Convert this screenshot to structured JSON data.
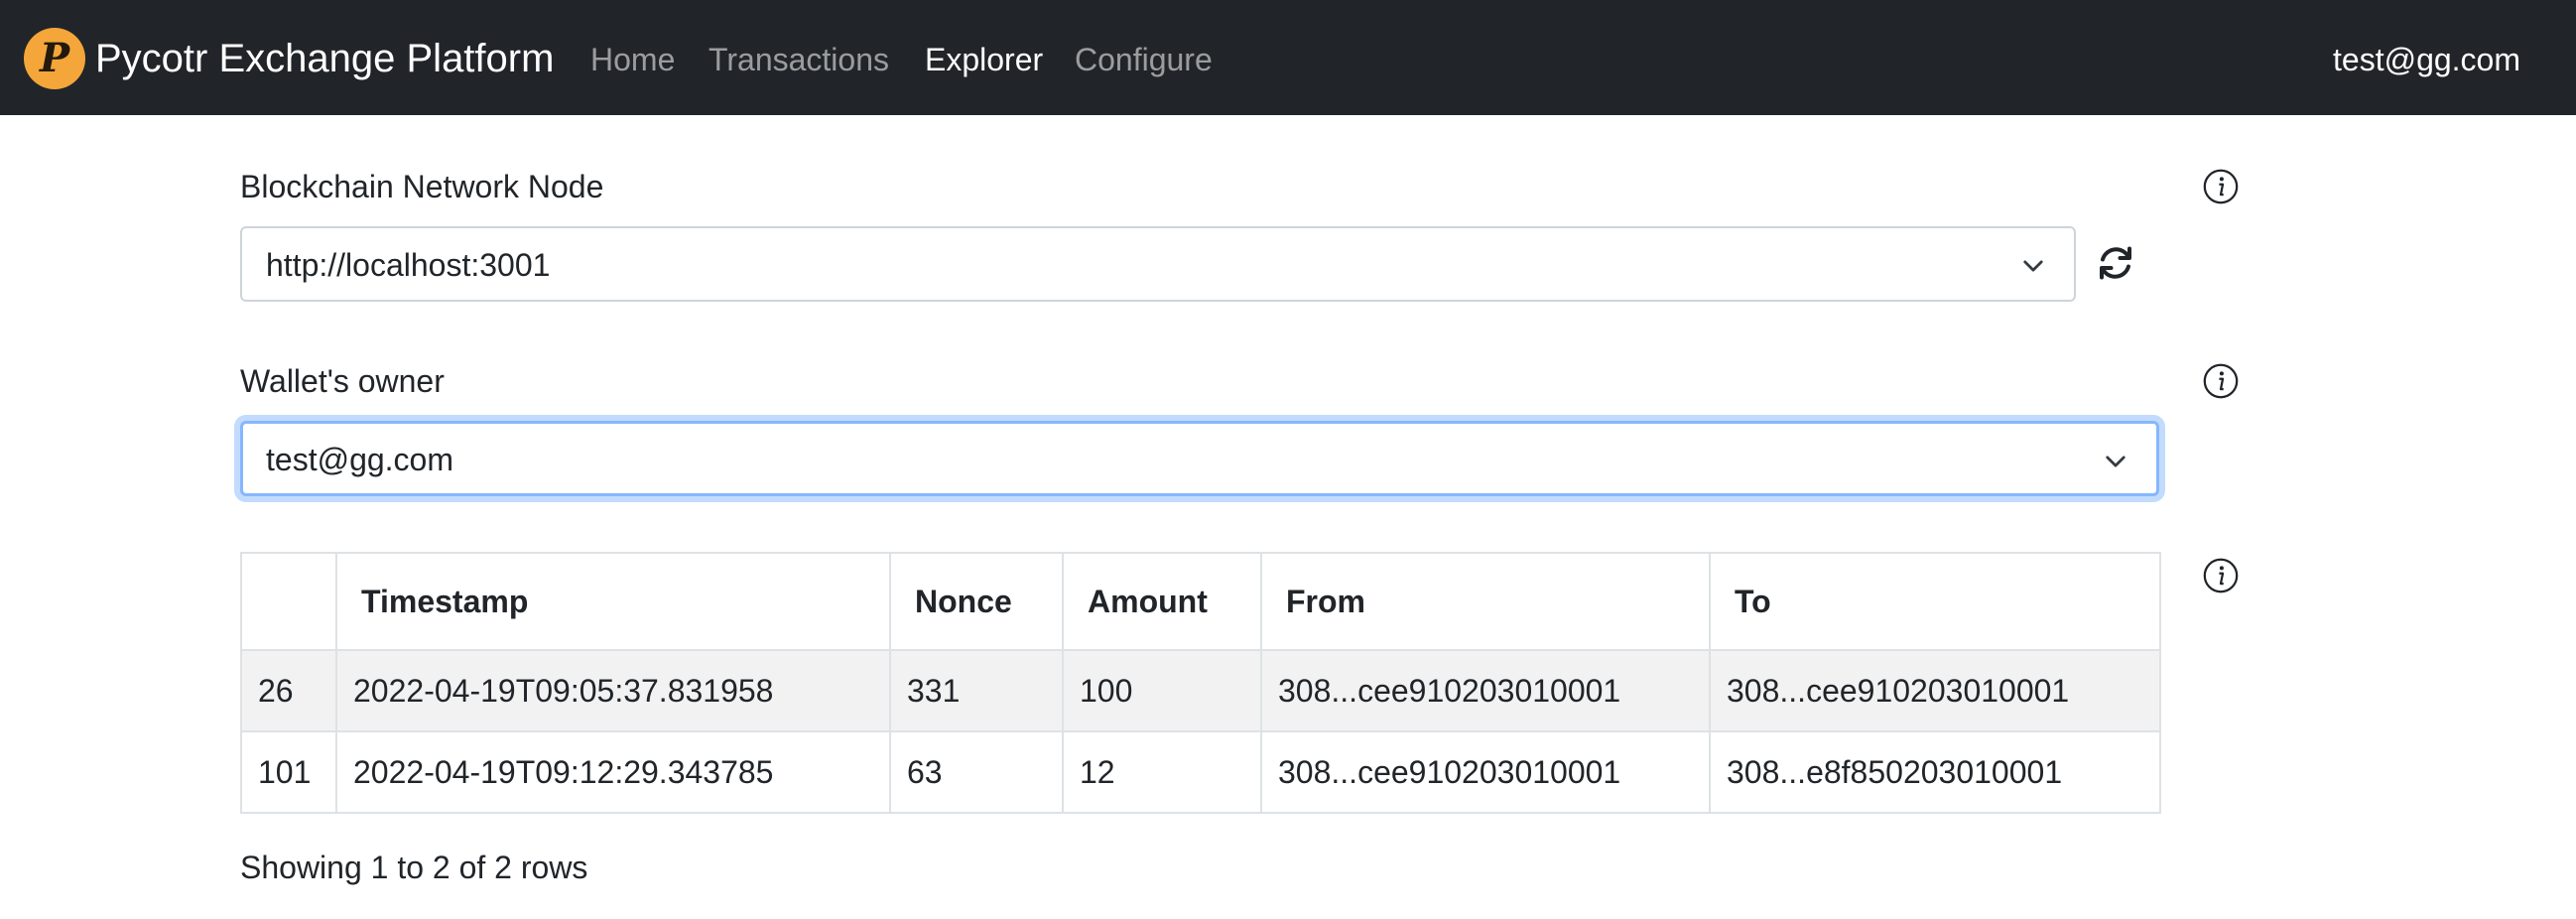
{
  "navbar": {
    "brand_logo_letter": "P",
    "brand_name": "Pycotr Exchange Platform",
    "links": [
      {
        "label": "Home",
        "active": false
      },
      {
        "label": "Transactions",
        "active": false
      },
      {
        "label": "Explorer",
        "active": true
      },
      {
        "label": "Configure",
        "active": false
      }
    ],
    "user": "test@gg.com"
  },
  "node_select": {
    "label": "Blockchain Network Node",
    "value": "http://localhost:3001"
  },
  "owner_select": {
    "label": "Wallet's owner",
    "value": "test@gg.com"
  },
  "table": {
    "columns": [
      "",
      "Timestamp",
      "Nonce",
      "Amount",
      "From",
      "To"
    ],
    "rows": [
      [
        "26",
        "2022-04-19T09:05:37.831958",
        "331",
        "100",
        "308...cee910203010001",
        "308...cee910203010001"
      ],
      [
        "101",
        "2022-04-19T09:12:29.343785",
        "63",
        "12",
        "308...cee910203010001",
        "308...e8f850203010001"
      ]
    ]
  },
  "pagination": {
    "summary": "Showing 1 to 2 of 2 rows"
  },
  "colors": {
    "navbar_bg": "#212529",
    "logo_orange": "#f4a63a",
    "focus_border": "#86b7fe",
    "stripe_bg": "#f2f2f2"
  },
  "icons": [
    "bitcoin-logo-icon",
    "chevron-down-icon",
    "refresh-icon",
    "info-icon"
  ]
}
